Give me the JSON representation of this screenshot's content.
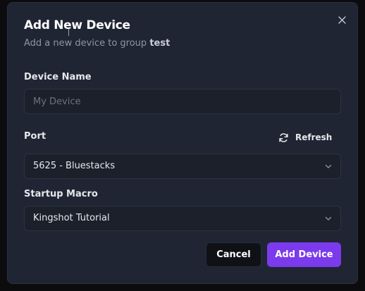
{
  "dialog": {
    "title": "Add New Device",
    "subtitle_prefix": "Add a new device to group ",
    "group_name": "test"
  },
  "device_name": {
    "label": "Device Name",
    "placeholder": "My Device",
    "value": ""
  },
  "port": {
    "label": "Port",
    "refresh_label": "Refresh",
    "selected": "5625 - Bluestacks"
  },
  "startup_macro": {
    "label": "Startup Macro",
    "selected": "Kingshot Tutorial"
  },
  "actions": {
    "cancel_label": "Cancel",
    "add_label": "Add Device"
  },
  "colors": {
    "accent": "#7c3aed",
    "panel": "#1f2532",
    "field": "#1b202b"
  },
  "icons": {
    "close": "close-icon",
    "refresh": "refresh-icon",
    "chevron": "chevron-down-icon"
  }
}
